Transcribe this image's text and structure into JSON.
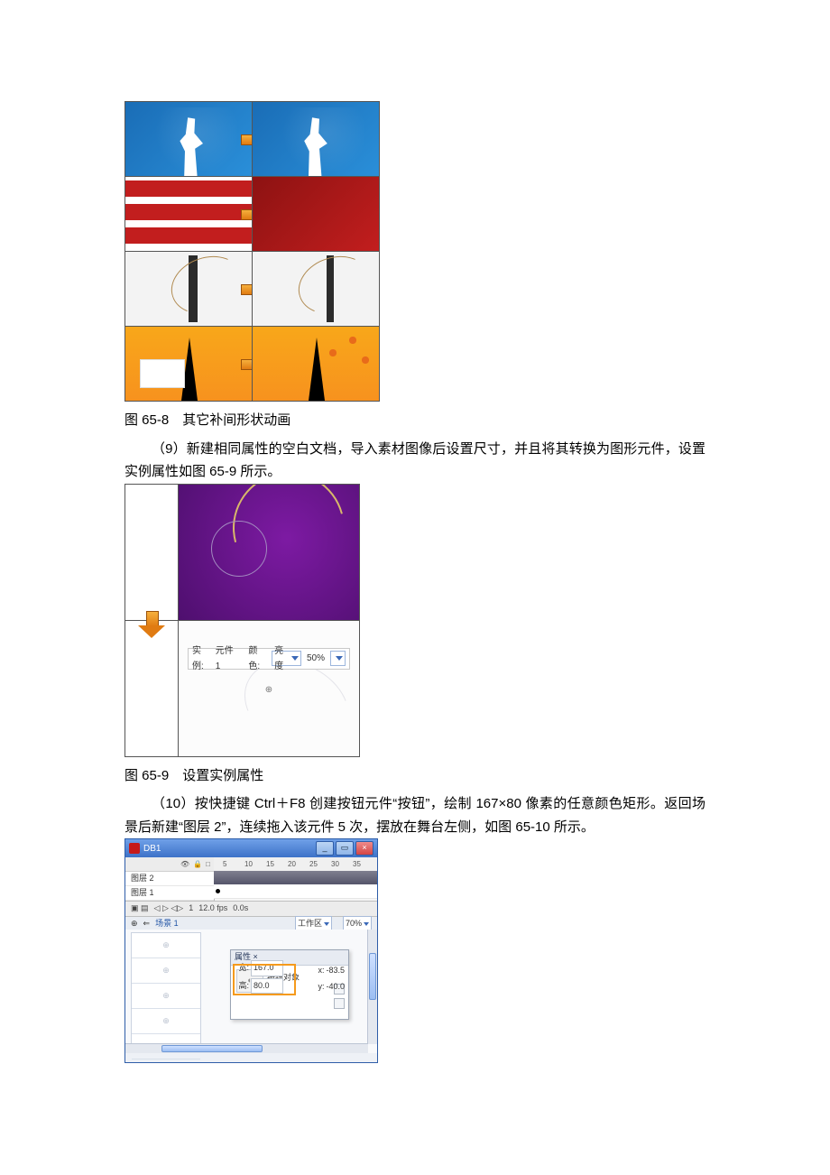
{
  "fig8_caption": "图 65-8　其它补间形状动画",
  "para9": "（9）新建相同属性的空白文档，导入素材图像后设置尺寸，并且将其转换为图形元件，设置实例属性如图 65-9 所示。",
  "fig9_caption": "图 65-9　设置实例属性",
  "para10": "（10）按快捷键 Ctrl＋F8 创建按钮元件“按钮”，绘制 167×80 像素的任意颜色矩形。返回场景后新建“图层 2”，连续拖入该元件 5 次，摆放在舞台左侧，如图 65-10 所示。",
  "fig9": {
    "instance_label": "实例:",
    "instance_value": "元件 1",
    "color_label": "颜色:",
    "color_value": "亮度",
    "pct_value": "50%"
  },
  "fig10": {
    "title": "DB1",
    "layer2": "图层 2",
    "layer1": "图层 1",
    "ruler": [
      "5",
      "10",
      "15",
      "20",
      "25",
      "30",
      "35"
    ],
    "status_frame": "1",
    "status_fps": "12.0 fps",
    "status_time": "0.0s",
    "scene": "场景 1",
    "workarea": "工作区",
    "zoom": "70%",
    "panel_tab": "属性 ×",
    "panel_sub": "按钮对象",
    "w_label": "宽:",
    "w_value": "167.0",
    "h_label": "高:",
    "h_value": "80.0",
    "x_label": "x:",
    "x_value": "-83.5",
    "y_label": "y:",
    "y_value": "-40.0"
  }
}
